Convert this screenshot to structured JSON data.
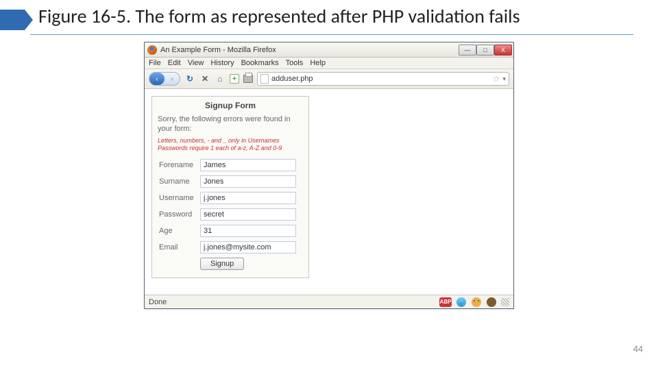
{
  "slide": {
    "title": "Figure 16-5. The form as represented after PHP validation fails",
    "page_number": "44"
  },
  "browser": {
    "window_title": "An Example Form - Mozilla Firefox",
    "menu": {
      "file": "File",
      "edit": "Edit",
      "view": "View",
      "history": "History",
      "bookmarks": "Bookmarks",
      "tools": "Tools",
      "help": "Help"
    },
    "address": "adduser.php",
    "status": "Done"
  },
  "form": {
    "title": "Signup Form",
    "sorry": "Sorry, the following errors were found in your form:",
    "error_line1": "Letters, numbers, - and _ only in Usernames",
    "error_line2": "Passwords require 1 each of a-z, A-Z and 0-9",
    "labels": {
      "forename": "Forename",
      "surname": "Surname",
      "username": "Username",
      "password": "Password",
      "age": "Age",
      "email": "Email"
    },
    "values": {
      "forename": "James",
      "surname": "Jones",
      "username": "j.jones",
      "password": "secret",
      "age": "31",
      "email": "j.jones@mysite.com"
    },
    "submit": "Signup"
  },
  "icons": {
    "min": "—",
    "max": "□",
    "close": "X",
    "back": "‹",
    "fwd": "›",
    "reload": "↻",
    "stop": "✕",
    "home": "⌂",
    "plus": "+",
    "star": "☆",
    "chev": "▾",
    "abp": "ABP"
  }
}
